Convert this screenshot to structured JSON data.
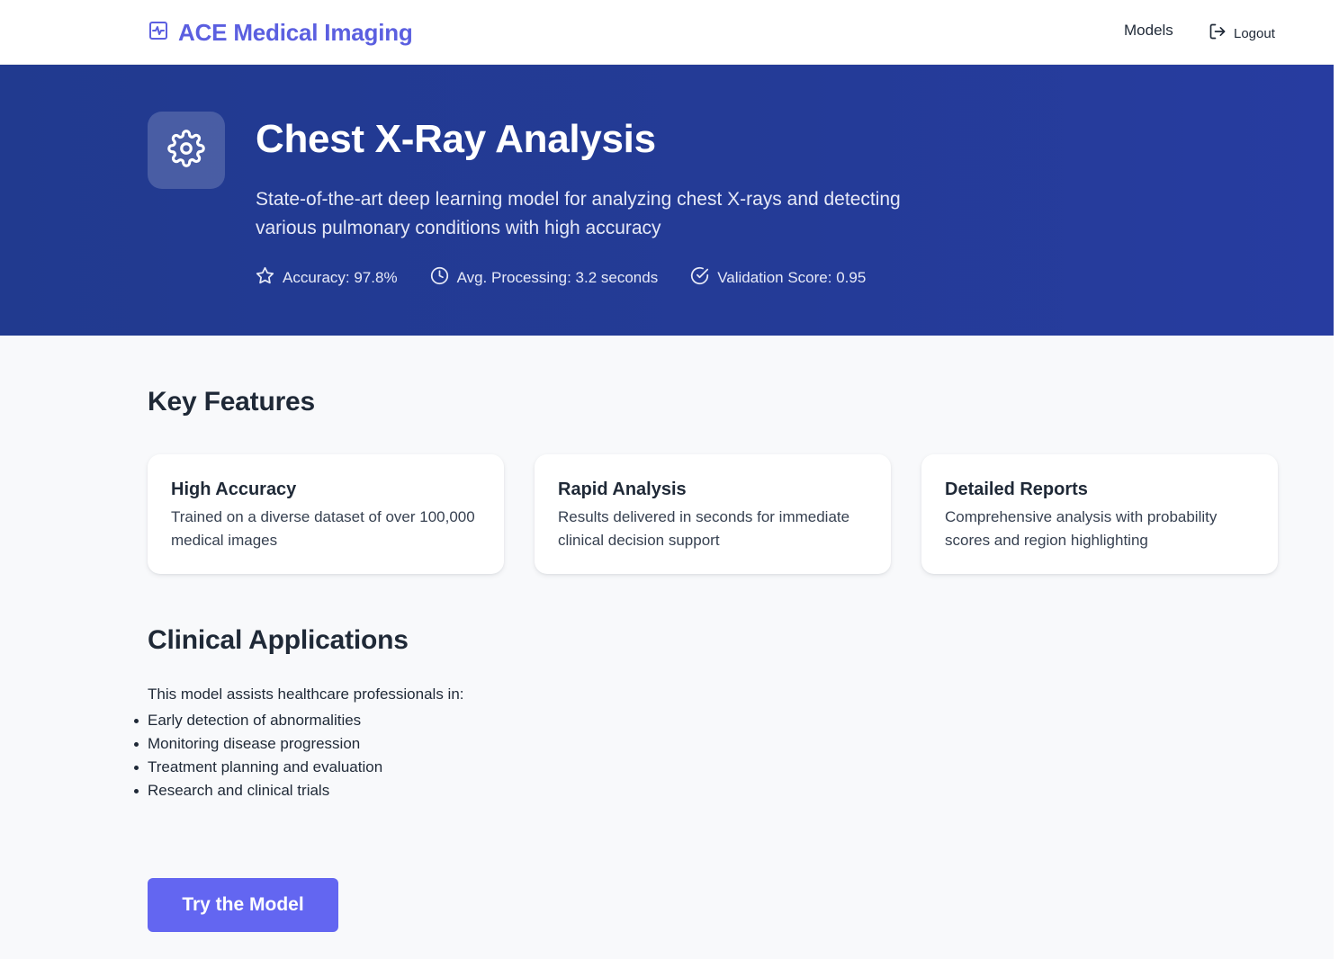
{
  "brand": {
    "title": "ACE Medical Imaging",
    "icon": "activity-icon",
    "color": "#5b5fe0"
  },
  "nav": {
    "models_label": "Models",
    "logout_label": "Logout",
    "logout_icon": "logout-icon"
  },
  "hero": {
    "icon": "gear-icon",
    "title": "Chest X-Ray Analysis",
    "description": "State-of-the-art deep learning model for analyzing chest X-rays and detecting various pulmonary conditions with high accuracy",
    "stats": [
      {
        "icon": "star-icon",
        "label": "Accuracy: 97.8%"
      },
      {
        "icon": "clock-icon",
        "label": "Avg. Processing: 3.2 seconds"
      },
      {
        "icon": "check-circle-icon",
        "label": "Validation Score: 0.95"
      }
    ],
    "background": "#243b97"
  },
  "features": {
    "heading": "Key Features",
    "cards": [
      {
        "title": "High Accuracy",
        "description": "Trained on a diverse dataset of over 100,000 medical images"
      },
      {
        "title": "Rapid Analysis",
        "description": "Results delivered in seconds for immediate clinical decision support"
      },
      {
        "title": "Detailed Reports",
        "description": "Comprehensive analysis with probability scores and region highlighting"
      }
    ]
  },
  "clinical": {
    "heading": "Clinical Applications",
    "intro": "This model assists healthcare professionals in:",
    "items": [
      "Early detection of abnormalities",
      "Monitoring disease progression",
      "Treatment planning and evaluation",
      "Research and clinical trials"
    ]
  },
  "cta": {
    "label": "Try the Model",
    "color": "#6366f1"
  }
}
